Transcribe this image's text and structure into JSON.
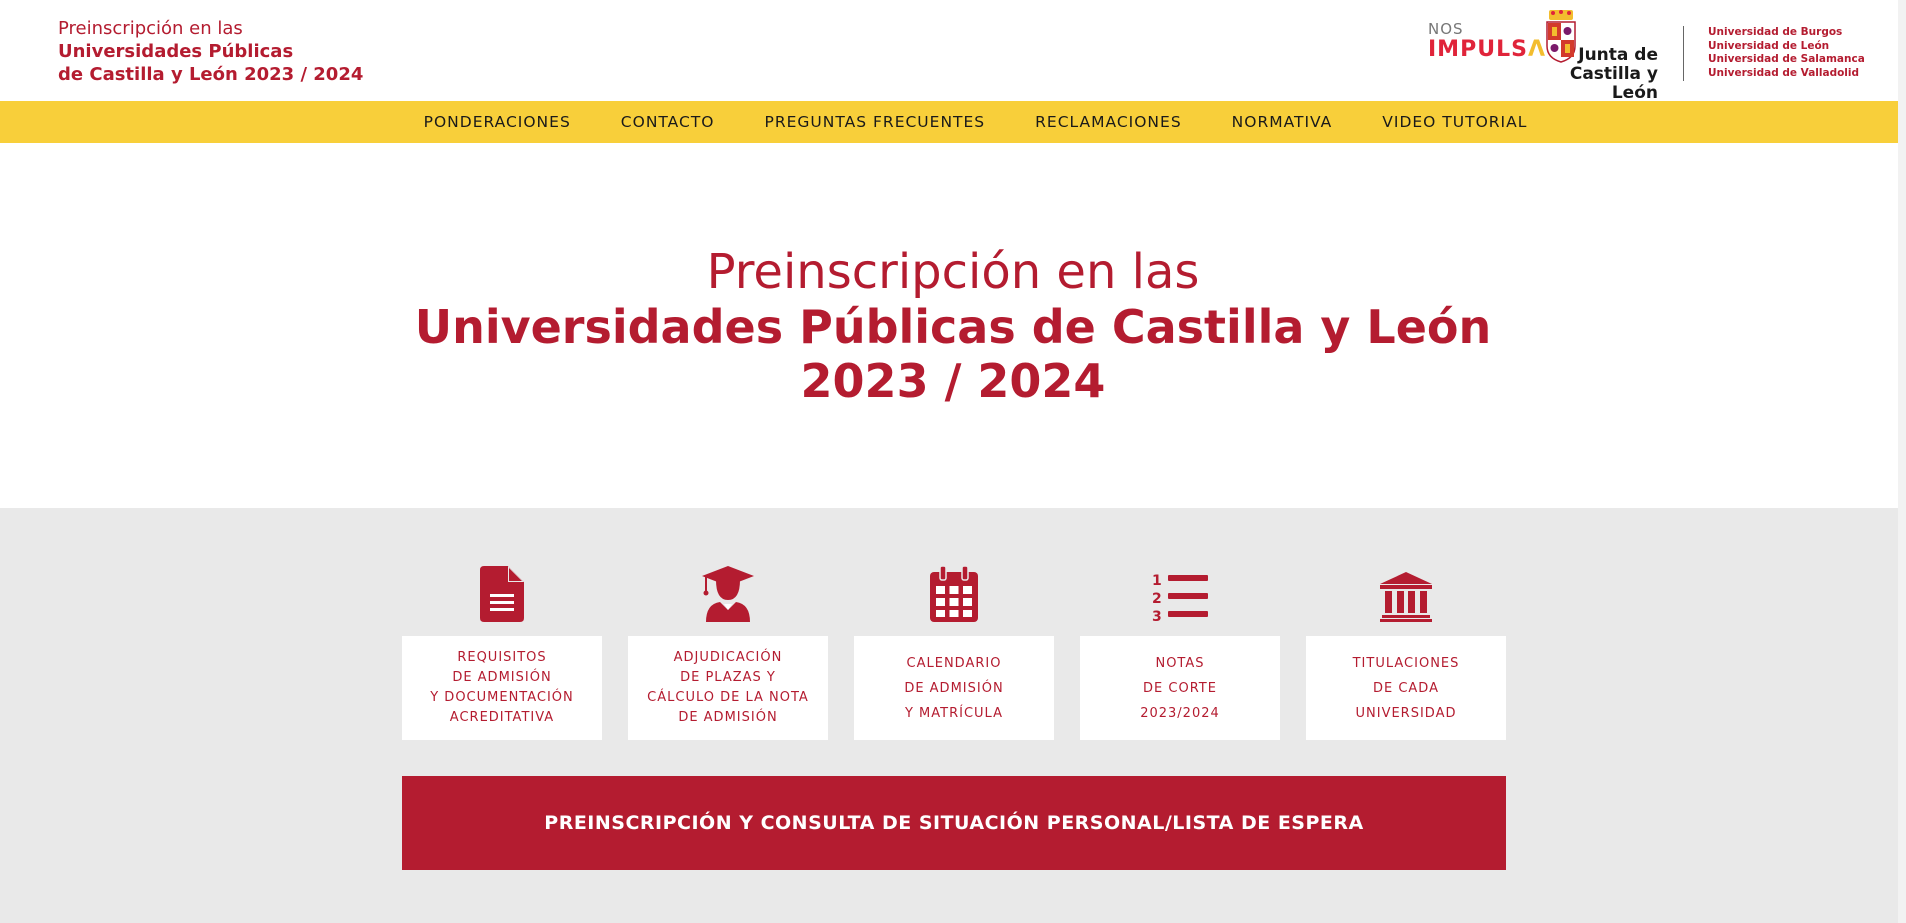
{
  "header": {
    "brand_line1": "Preinscripción en las",
    "brand_line2": "Universidades Públicas",
    "brand_line3": "de Castilla y León 2023 / 2024",
    "nos": "NOS",
    "impuls": "IMPULS",
    "impuls_a": "Λ",
    "junta_line1": "Junta de",
    "junta_line2": "Castilla y León",
    "universities": [
      "Universidad de Burgos",
      "Universidad de León",
      "Universidad de Salamanca",
      "Universidad de Valladolid"
    ]
  },
  "nav": {
    "items": [
      "PONDERACIONES",
      "CONTACTO",
      "PREGUNTAS FRECUENTES",
      "RECLAMACIONES",
      "NORMATIVA",
      "VIDEO TUTORIAL"
    ]
  },
  "hero": {
    "line1": "Preinscripción en las",
    "line2": "Universidades Públicas de Castilla y León",
    "line3": "2023 / 2024"
  },
  "cards": [
    {
      "icon": "document-icon",
      "label": "REQUISITOS\nDE ADMISIÓN\nY DOCUMENTACIÓN\nACREDITATIVA"
    },
    {
      "icon": "graduate-icon",
      "label": "ADJUDICACIÓN\nDE PLAZAS Y\nCÁLCULO DE LA NOTA\nDE ADMISIÓN"
    },
    {
      "icon": "calendar-icon",
      "label": "CALENDARIO\nDE ADMISIÓN\nY MATRÍCULA"
    },
    {
      "icon": "numbered-list-icon",
      "label": "NOTAS\nDE CORTE\n2023/2024"
    },
    {
      "icon": "institution-icon",
      "label": "TITULACIONES\nDE CADA\nUNIVERSIDAD"
    }
  ],
  "cta": {
    "label": "PREINSCRIPCIÓN Y CONSULTA DE SITUACIÓN PERSONAL/LISTA DE ESPERA"
  },
  "colors": {
    "brand_red": "#b41c30",
    "nav_yellow": "#f8cf3a",
    "grey_bg": "#e9e9e9"
  }
}
